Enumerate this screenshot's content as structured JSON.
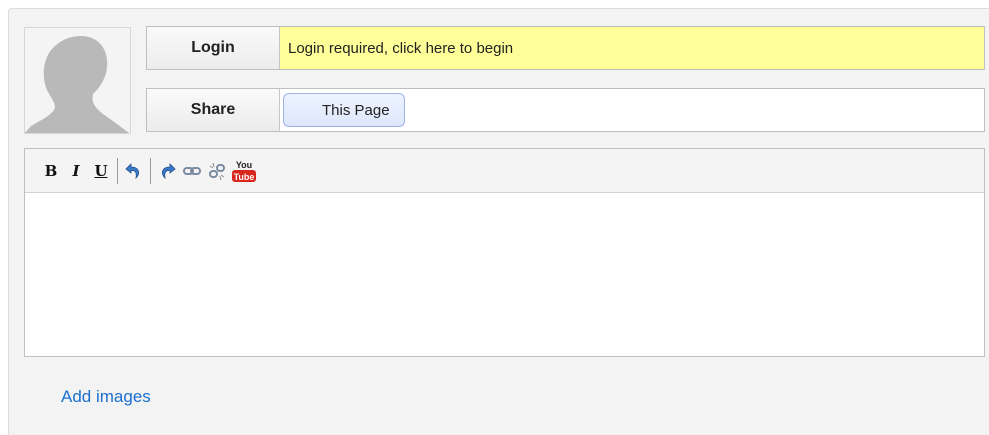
{
  "login": {
    "label": "Login",
    "message": "Login required, click here to begin"
  },
  "share": {
    "label": "Share",
    "button_label": "This Page"
  },
  "toolbar": {
    "bold_label": "B",
    "italic_label": "I",
    "underline_label": "U",
    "icons": [
      "undo-icon",
      "redo-icon",
      "link-icon",
      "unlink-icon",
      "youtube-icon"
    ],
    "youtube_top": "You",
    "youtube_bottom": "Tube"
  },
  "editor": {
    "content": ""
  },
  "add_images_label": "Add images",
  "colors": {
    "panel_background": "#f3f3f3",
    "login_message_background": "#ffff99",
    "link_color": "#1a6fcf",
    "youtube_red": "#d9261c",
    "icon_blue": "#3a78c8"
  }
}
